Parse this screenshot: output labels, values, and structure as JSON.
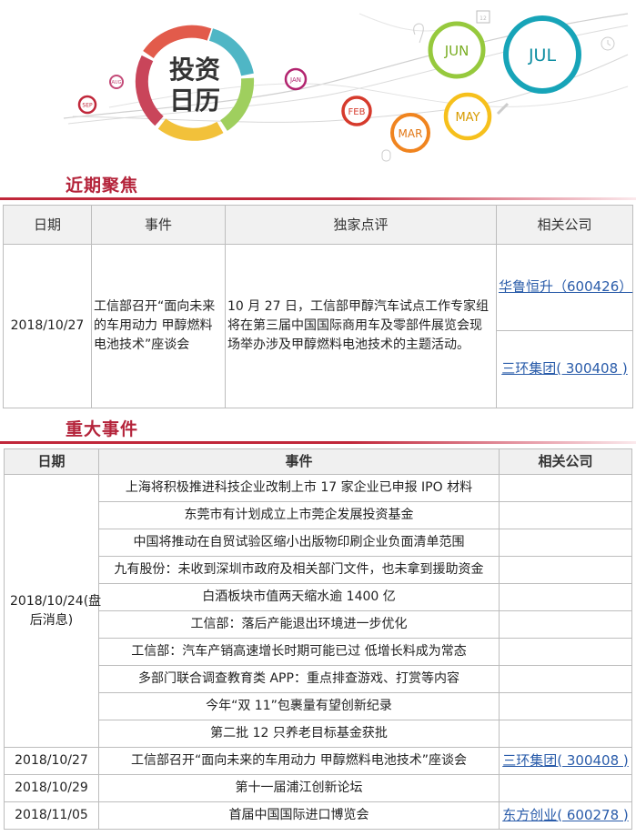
{
  "banner": {
    "title_line1": "投资",
    "title_line2": "日历",
    "months": [
      "SEP",
      "AUG",
      "JAN",
      "FEB",
      "MAR",
      "MAY",
      "JUN",
      "JUL"
    ],
    "calendar_icon_text": "12"
  },
  "section1": {
    "title": "近期聚焦",
    "headers": [
      "日期",
      "事件",
      "独家点评",
      "相关公司"
    ],
    "row": {
      "date": "2018/10/27",
      "event": "工信部召开“面向未来的车用动力 甲醇燃料电池技术”座谈会",
      "comment": "10 月 27 日，工信部甲醇汽车试点工作专家组将在第三届中国国际商用车及零部件展览会现场举办涉及甲醇燃料电池技术的主题活动。",
      "companies": [
        "华鲁恒升（600426）",
        "三环集团( 300408 )"
      ]
    }
  },
  "section2": {
    "title": "重大事件",
    "headers": [
      "日期",
      "事件",
      "相关公司"
    ],
    "group1": {
      "date": "2018/10/24(盘后消息)",
      "events": [
        "上海将积极推进科技企业改制上市 17 家企业已申报 IPO 材料",
        "东莞市有计划成立上市莞企发展投资基金",
        "中国将推动在自贸试验区缩小出版物印刷企业负面清单范围",
        "九有股份：未收到深圳市政府及相关部门文件，也未拿到援助资金",
        "白酒板块市值两天缩水逾 1400 亿",
        "工信部：落后产能退出环境进一步优化",
        "工信部：汽车产销高速增长时期可能已过 低增长料成为常态",
        "多部门联合调查教育类 APP：重点排查游戏、打赏等内容",
        "今年“双 11”包裹量有望创新纪录",
        "第二批 12 只养老目标基金获批"
      ]
    },
    "rows": [
      {
        "date": "2018/10/27",
        "event": "工信部召开“面向未来的车用动力 甲醇燃料电池技术”座谈会",
        "company": "三环集团( 300408 )"
      },
      {
        "date": "2018/10/29",
        "event": "第十一届浦江创新论坛",
        "company": ""
      },
      {
        "date": "2018/11/05",
        "event": "首届中国国际进口博览会",
        "company": "东方创业( 600278 )"
      }
    ]
  }
}
